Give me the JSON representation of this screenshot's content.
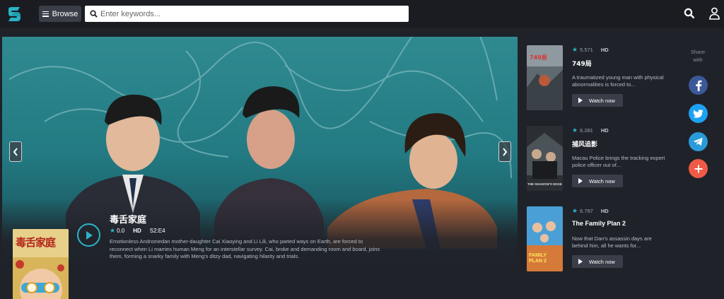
{
  "header": {
    "browse_label": "Browse",
    "search_placeholder": "Enter keywords..."
  },
  "hero": {
    "title": "毒舌家庭",
    "rating": "0.0",
    "quality": "HD",
    "episode": "S2:E4",
    "description": "Emotionless Andromedan mother-daughter Cai Xiaoying and Li Lili, who parted ways on Earth, are forced to reconnect when Li marries human Meng for an interstellar survey. Cai, broke and demanding room and board, joins them, forming a snarky family with Meng's ditzy dad, navigating hilarity and trials.",
    "poster_text": "毒舌家庭"
  },
  "sidebar": {
    "items": [
      {
        "rating": "5.571",
        "quality": "HD",
        "title": "749局",
        "description": "A traumatized young man with physical abnormalities is forced to...",
        "watch_label": "Watch now",
        "poster_text": "749局"
      },
      {
        "rating": "6.281",
        "quality": "HD",
        "title": "捕风追影",
        "description": "Macau Police brings the tracking expert police officer out of...",
        "watch_label": "Watch now",
        "poster_text": "THE SHADOW'S EDGE"
      },
      {
        "rating": "6.797",
        "quality": "HD",
        "title": "The Family Plan 2",
        "description": "Now that Dan's assassin days are behind him, all he wants for...",
        "watch_label": "Watch now",
        "poster_text": "FAMILY PLAN 2"
      }
    ]
  },
  "share": {
    "label": "Share with",
    "buttons": [
      {
        "name": "facebook",
        "color": "#3b5998"
      },
      {
        "name": "twitter",
        "color": "#1da1f2"
      },
      {
        "name": "telegram",
        "color": "#2a9bd8"
      },
      {
        "name": "more",
        "color": "#ef5a47"
      }
    ]
  },
  "colors": {
    "background": "#1f2229",
    "accent": "#2ab4c7",
    "button": "#3a3e48"
  }
}
